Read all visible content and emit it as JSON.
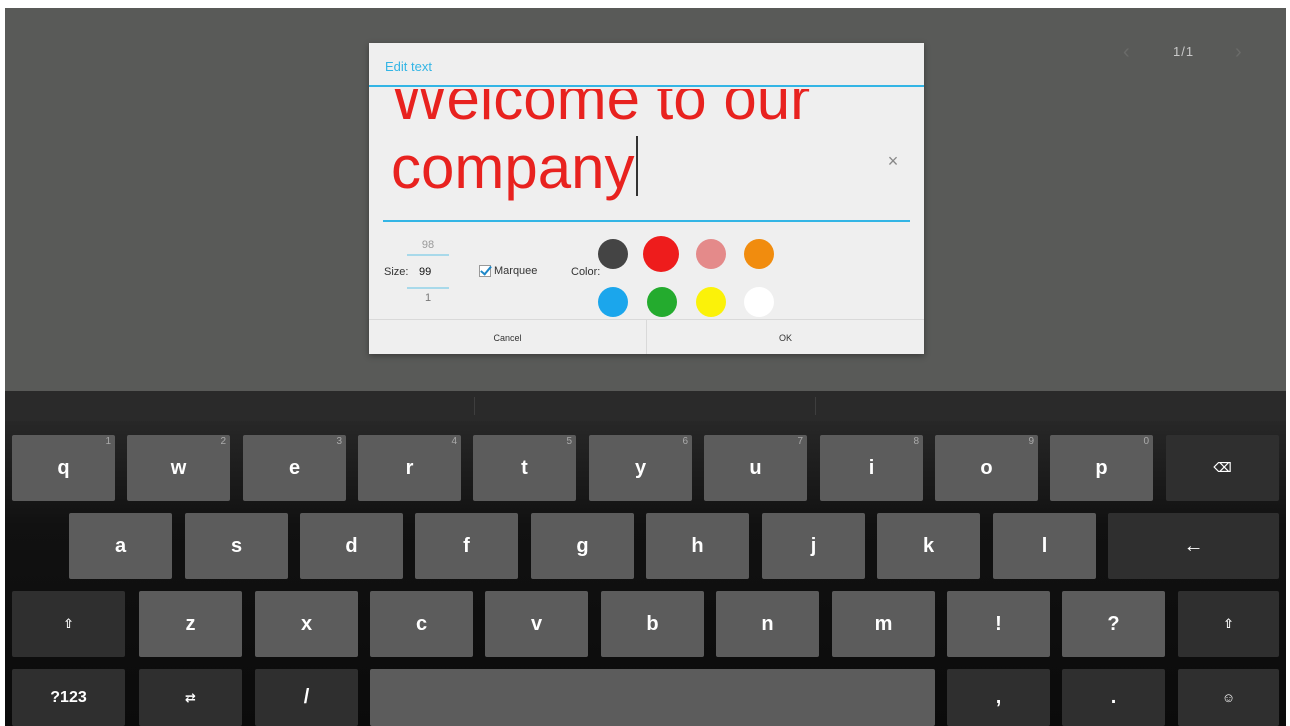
{
  "pager": {
    "prev_icon": "chevron-left-icon",
    "count": "1/1",
    "next_icon": "chevron-right-icon"
  },
  "dialog": {
    "title": "Edit text",
    "text_lines": [
      "Welcome to our",
      "company"
    ],
    "clear_icon": "close-icon",
    "size": {
      "label": "Size:",
      "previous": "98",
      "current": "99",
      "next": "1"
    },
    "marquee": {
      "label": "Marquee",
      "checked": true
    },
    "color_label": "Color:",
    "colors": [
      "#444444",
      "#ee1c1c",
      "#e48a8a",
      "#f18c0e",
      "#1ba6ec",
      "#24ab2e",
      "#fbf209",
      "#ffffff"
    ],
    "selected_color": "#ee1c1c",
    "cancel_label": "Cancel",
    "ok_label": "OK"
  },
  "keyboard": {
    "row1": [
      {
        "label": "q",
        "hint": "1"
      },
      {
        "label": "w",
        "hint": "2"
      },
      {
        "label": "e",
        "hint": "3"
      },
      {
        "label": "r",
        "hint": "4"
      },
      {
        "label": "t",
        "hint": "5"
      },
      {
        "label": "y",
        "hint": "6"
      },
      {
        "label": "u",
        "hint": "7"
      },
      {
        "label": "i",
        "hint": "8"
      },
      {
        "label": "o",
        "hint": "9"
      },
      {
        "label": "p",
        "hint": "0"
      }
    ],
    "row2": [
      "a",
      "s",
      "d",
      "f",
      "g",
      "h",
      "j",
      "k",
      "l"
    ],
    "row3": [
      "z",
      "x",
      "c",
      "v",
      "b",
      "n",
      "m",
      "!",
      "?"
    ],
    "symbols_label": "?123",
    "slash_label": "/",
    "comma_label": ",",
    "period_label": ".",
    "backspace_icon": "backspace-icon",
    "enter_icon": "enter-icon",
    "shift_icon": "shift-icon",
    "settings_icon": "keyboard-settings-icon",
    "emoji_icon": "emoji-icon"
  }
}
